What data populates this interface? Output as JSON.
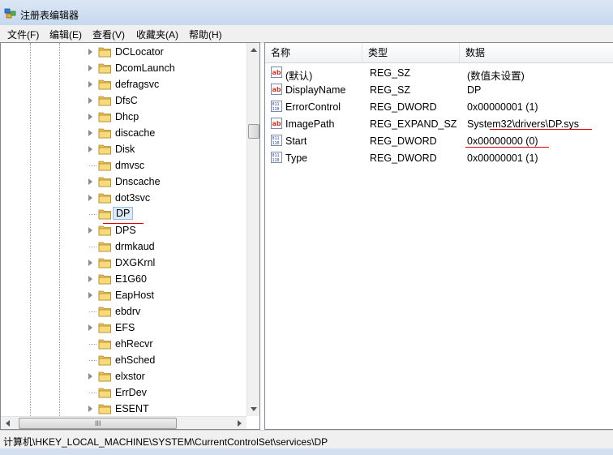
{
  "window": {
    "title": "注册表编辑器",
    "icon": "registry-editor-icon"
  },
  "menu": [
    "文件(F)",
    "编辑(E)",
    "查看(V)",
    "收藏夹(A)",
    "帮助(H)"
  ],
  "tree": {
    "items": [
      "DCLocator",
      "DcomLaunch",
      "defragsvc",
      "DfsC",
      "Dhcp",
      "discache",
      "Disk",
      "dmvsc",
      "Dnscache",
      "dot3svc",
      "DP",
      "DPS",
      "drmkaud",
      "DXGKrnl",
      "E1G60",
      "EapHost",
      "ebdrv",
      "EFS",
      "ehRecvr",
      "ehSched",
      "elxstor",
      "ErrDev",
      "ESENT"
    ],
    "expandable": [
      true,
      true,
      true,
      true,
      true,
      true,
      true,
      false,
      true,
      true,
      false,
      true,
      false,
      true,
      true,
      true,
      false,
      true,
      false,
      false,
      true,
      false,
      true
    ],
    "selected": "DP"
  },
  "hscroll_grip": "III",
  "columns": {
    "name": "名称",
    "type": "类型",
    "data": "数据"
  },
  "values": [
    {
      "name": "(默认)",
      "type": "REG_SZ",
      "data": "(数值未设置)",
      "icon": "string-value-icon"
    },
    {
      "name": "DisplayName",
      "type": "REG_SZ",
      "data": "DP",
      "icon": "string-value-icon"
    },
    {
      "name": "ErrorControl",
      "type": "REG_DWORD",
      "data": "0x00000001 (1)",
      "icon": "binary-value-icon"
    },
    {
      "name": "ImagePath",
      "type": "REG_EXPAND_SZ",
      "data": "System32\\drivers\\DP.sys",
      "icon": "string-value-icon"
    },
    {
      "name": "Start",
      "type": "REG_DWORD",
      "data": "0x00000000 (0)",
      "icon": "binary-value-icon"
    },
    {
      "name": "Type",
      "type": "REG_DWORD",
      "data": "0x00000001 (1)",
      "icon": "binary-value-icon"
    }
  ],
  "status": {
    "path": "计算机\\HKEY_LOCAL_MACHINE\\SYSTEM\\CurrentControlSet\\services\\DP"
  },
  "colors": {
    "annotation_red": "#e00000",
    "selection": "#dce9f7"
  }
}
